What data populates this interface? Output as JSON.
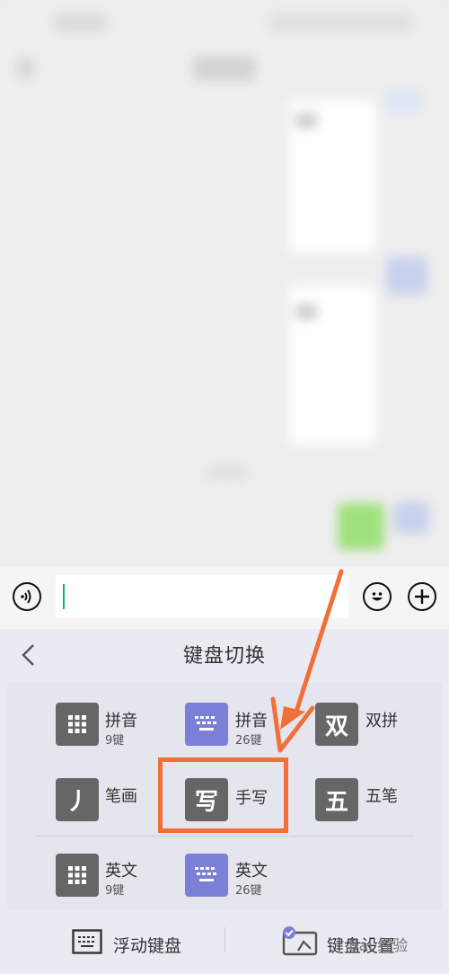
{
  "keyboard": {
    "title": "键盘切换",
    "options": [
      {
        "label": "拼音",
        "sub": "9键"
      },
      {
        "label": "拼音",
        "sub": "26键"
      },
      {
        "label": "双拼",
        "glyph": "双"
      },
      {
        "label": "笔画",
        "glyph": "丿"
      },
      {
        "label": "手写",
        "glyph": "写"
      },
      {
        "label": "五笔",
        "glyph": "五"
      },
      {
        "label": "英文",
        "sub": "9键"
      },
      {
        "label": "英文",
        "sub": "26键"
      }
    ],
    "bottom": {
      "floating": "浮动键盘",
      "settings": "键盘设置"
    }
  },
  "watermark": "Bai 经验",
  "colors": {
    "accent": "#f0703a",
    "tile_dark": "#666666",
    "tile_blue": "#7b7fd8",
    "caret": "#16b36e"
  }
}
